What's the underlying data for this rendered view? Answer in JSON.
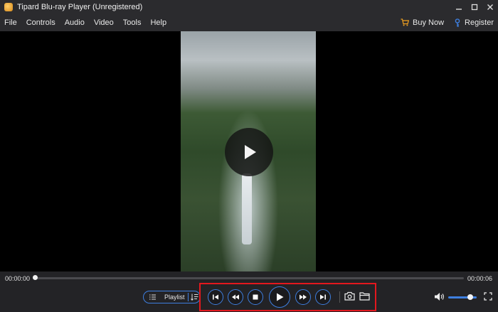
{
  "window": {
    "title": "Tipard Blu-ray Player (Unregistered)",
    "controls": [
      "minimize-icon",
      "maximize-icon",
      "close-icon"
    ]
  },
  "menubar": {
    "items": [
      {
        "label": "File"
      },
      {
        "label": "Controls"
      },
      {
        "label": "Audio"
      },
      {
        "label": "Video"
      },
      {
        "label": "Tools"
      },
      {
        "label": "Help"
      }
    ],
    "buy_now": "Buy Now",
    "register": "Register"
  },
  "player": {
    "current_time": "00:00:00",
    "duration": "00:00:06",
    "progress": 0.0,
    "volume": 0.85
  },
  "playlist": {
    "label": "Playlist"
  },
  "controls": {
    "buttons": [
      "previous-icon",
      "rewind-icon",
      "stop-icon",
      "play-icon",
      "fast-forward-icon",
      "next-icon"
    ],
    "tools": [
      "snapshot-icon",
      "open-folder-icon"
    ]
  },
  "colors": {
    "accent": "#3e7fe0",
    "highlight": "#e3181e",
    "chrome": "#2b2b2e"
  }
}
